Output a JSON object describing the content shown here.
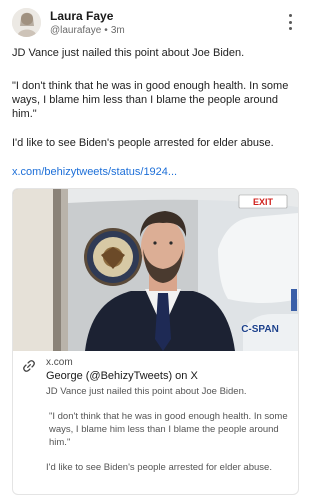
{
  "post": {
    "author": {
      "name": "Laura Faye",
      "handle": "@laurafaye",
      "separator": "•",
      "time": "3m"
    },
    "paragraphs": [
      "JD Vance just nailed this point about Joe Biden.",
      "\"I don't think that he was in good enough health. In some ways, I blame him less than I blame the people around him.\"",
      "I'd like to see Biden's people arrested for elder abuse."
    ],
    "link_text": "x.com/behizytweets/status/1924..."
  },
  "link_card": {
    "image": {
      "sign_text": "EXIT",
      "network_logo": "C-SPAN"
    },
    "domain": "x.com",
    "title": "George (@BehizyTweets) on X",
    "description": [
      "JD Vance just nailed this point about Joe Biden.",
      "\"I don't think that he was in good enough health. In some ways, I blame him less than I blame the people around him.\"",
      "I'd like to see Biden's people arrested for elder abuse."
    ]
  },
  "icons": {
    "more": "more-vertical-icon",
    "link": "link-icon"
  },
  "colors": {
    "link": "#1d6fd8",
    "exit_sign": "#d0231f",
    "background": "#ffffff"
  }
}
